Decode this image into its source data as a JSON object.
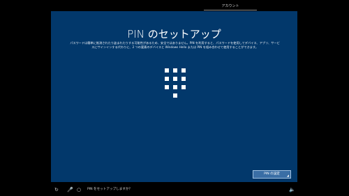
{
  "top_nav": {
    "active_tab": "アカウント"
  },
  "panel": {
    "title": "PIN のセットアップ",
    "description": "パスワードは簡単に推測されたり盗まれたりする可能性があるため、安全ではありません。PIN を利用すると、パスワードを使用してデバイス、アプリ、サービスにサインインする代わりに、2 つの要素のデバイスと Windows Hello または PIN を組み合わせて使用することができます。",
    "keypad_icon": "pin-keypad-icon",
    "button_label": "PIN の設定",
    "colors": {
      "panel_bg": "#02386b",
      "button_bg": "#3a6ea5"
    }
  },
  "bottom_bar": {
    "icons": [
      "accessibility-icon",
      "microphone-icon",
      "cortana-circle-icon",
      "speaker-icon"
    ],
    "prompt_text": "PIN をセットアップしますか？"
  }
}
